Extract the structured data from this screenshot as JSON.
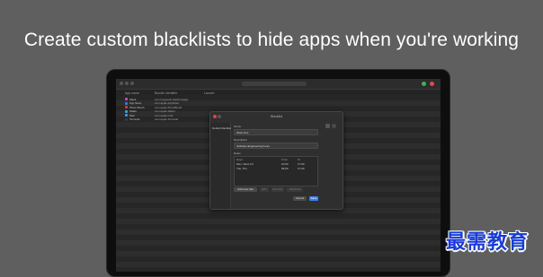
{
  "headline": "Create custom blacklists to hide apps when you're working",
  "app": {
    "columns": {
      "name": "App name",
      "bundle": "Bundle Identifier",
      "launch": "Launch"
    },
    "rows": [
      {
        "name": "Slack",
        "bundle": "com.tinyspeck.slackmacgap",
        "color": "#c94cb5"
      },
      {
        "name": "App Store",
        "bundle": "com.apple.AppStore",
        "color": "#2f7ef0"
      },
      {
        "name": "Photo Booth",
        "bundle": "com.apple.PhotoBooth",
        "color": "#d23b3b"
      },
      {
        "name": "Safari",
        "bundle": "com.apple.Safari",
        "color": "#3aa0e8"
      },
      {
        "name": "Mail",
        "bundle": "com.apple.mail",
        "color": "#4b8fe8"
      },
      {
        "name": "Terminal",
        "bundle": "com.apple.Terminal",
        "color": "#3b3b3b"
      }
    ],
    "accent": "#3b7ff0",
    "traffic_colors": [
      "#555555",
      "#555555",
      "#555555"
    ],
    "toolbar_buttons": [
      {
        "color": "#3fb34f"
      },
      {
        "color": "#e04a4a"
      }
    ]
  },
  "sheet": {
    "title": "Blacklist",
    "sidebar_item": "Default blacklist",
    "name_label": "Name",
    "name_value": "Work time",
    "desc_label": "Description",
    "desc_value": "Software Engineering hours",
    "rules_label": "Rules",
    "table_headers": {
      "days": "Days",
      "from": "From",
      "to": "To"
    },
    "rules": [
      {
        "days": "Mon, Wed, Fri",
        "from": "10:00",
        "to": "17:00"
      },
      {
        "days": "Tue, Thu",
        "from": "09:00",
        "to": "17:00"
      }
    ],
    "buttons": {
      "add": "Add new rule",
      "edit": "Edit",
      "remove": "Remove",
      "duplicate": "Duplicate",
      "cancel": "Cancel",
      "save": "Save"
    }
  },
  "watermark": "最需教育"
}
